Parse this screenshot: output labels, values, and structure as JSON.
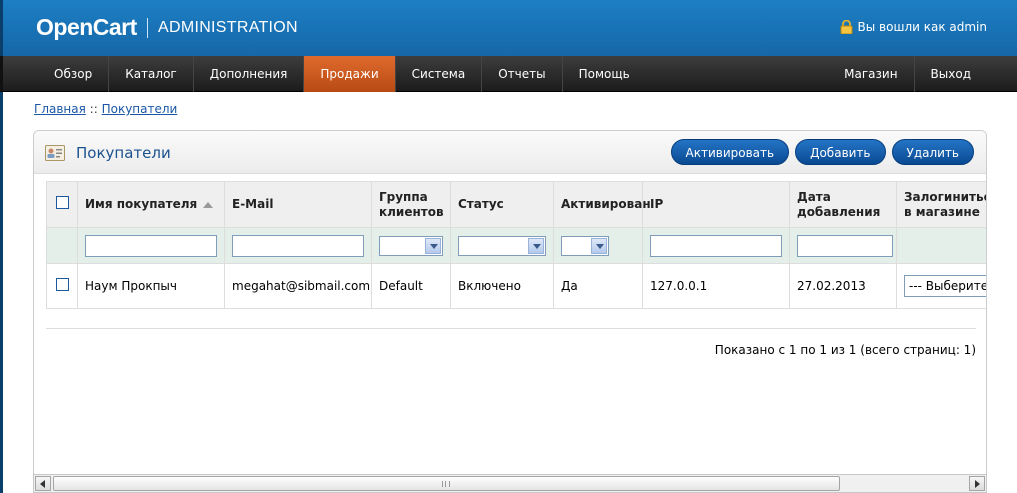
{
  "header": {
    "logo": "OpenCart",
    "subtitle": "ADMINISTRATION",
    "logged_in": "Вы вошли как admin"
  },
  "menu": {
    "left": [
      "Обзор",
      "Каталог",
      "Дополнения",
      "Продажи",
      "Система",
      "Отчеты",
      "Помощь"
    ],
    "right": [
      "Магазин",
      "Выход"
    ],
    "active": "Продажи"
  },
  "breadcrumb": {
    "home": "Главная",
    "separator": "::",
    "current": "Покупатели"
  },
  "panel": {
    "title": "Покупатели",
    "buttons": [
      "Активировать",
      "Добавить",
      "Удалить"
    ]
  },
  "table": {
    "headers": {
      "name": "Имя покупателя",
      "email": "E-Mail",
      "group": "Группа клиентов",
      "status": "Статус",
      "approved": "Активирован",
      "ip": "IP",
      "date": "Дата добавления",
      "login": "Залогиниться в магазине"
    },
    "rows": [
      {
        "name": "Наум Прокпыч",
        "email": "megahat@sibmail.com",
        "group": "Default",
        "status": "Включено",
        "approved": "Да",
        "ip": "127.0.0.1",
        "date": "27.02.2013",
        "login_select": "--- Выберите ---"
      }
    ]
  },
  "pagination": {
    "text": "Показано с 1 по 1 из 1 (всего страниц: 1)"
  },
  "colors": {
    "header_blue": "#1567a8",
    "menu_dark": "#1c1c1c",
    "active_orange": "#c8561c",
    "button_blue": "#0a4a93",
    "title_blue": "#1b5290"
  }
}
